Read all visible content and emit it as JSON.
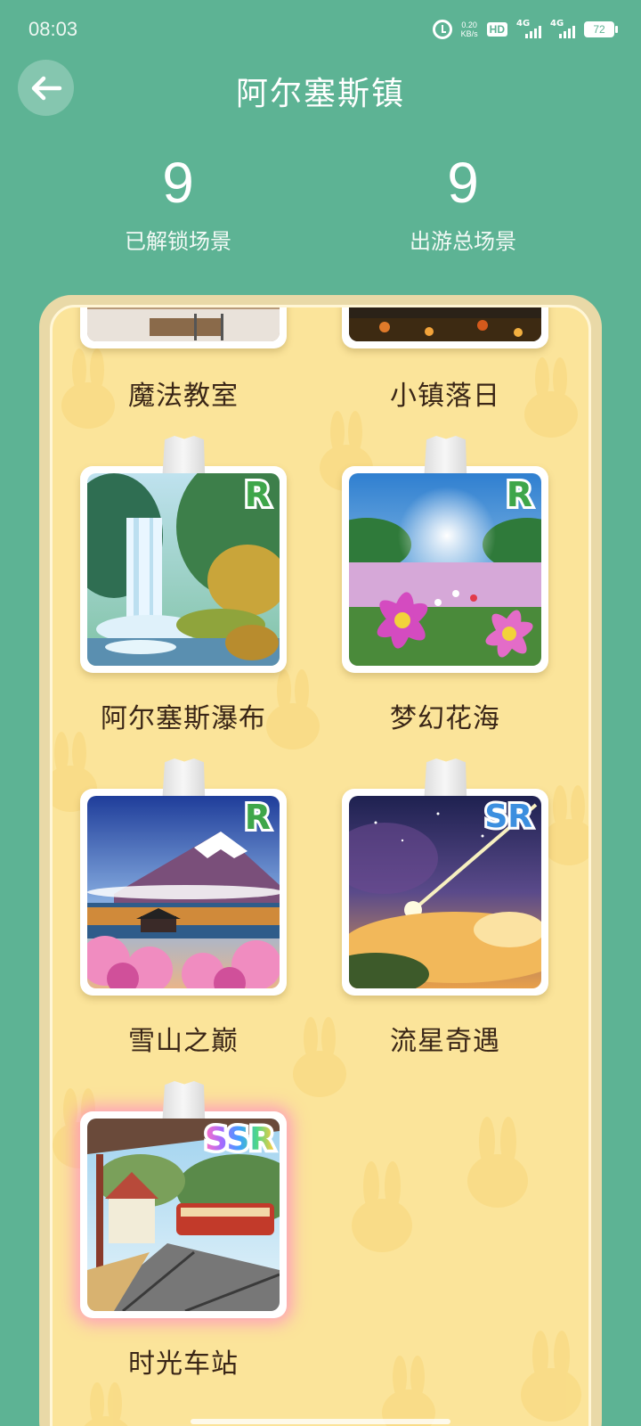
{
  "status_bar": {
    "time": "08:03",
    "net_speed_value": "0.20",
    "net_speed_unit": "KB/s",
    "hd_label": "HD",
    "signal1_label": "4G",
    "signal2_label": "4G",
    "battery": "72"
  },
  "header": {
    "title": "阿尔塞斯镇"
  },
  "stats": {
    "unlocked_count": "9",
    "unlocked_label": "已解锁场景",
    "total_count": "9",
    "total_label": "出游总场景"
  },
  "scenes": [
    {
      "name": "魔法教室",
      "rarity": ""
    },
    {
      "name": "小镇落日",
      "rarity": ""
    },
    {
      "name": "阿尔塞斯瀑布",
      "rarity": "R"
    },
    {
      "name": "梦幻花海",
      "rarity": "R"
    },
    {
      "name": "雪山之巅",
      "rarity": "R"
    },
    {
      "name": "流星奇遇",
      "rarity": "SR"
    },
    {
      "name": "时光车站",
      "rarity": "SSR"
    }
  ],
  "colors": {
    "background": "#5db394",
    "album": "#fbe49a",
    "caption": "#3a2617",
    "rarity_r": "#3fa64a",
    "rarity_sr": "#3c8fdf"
  }
}
